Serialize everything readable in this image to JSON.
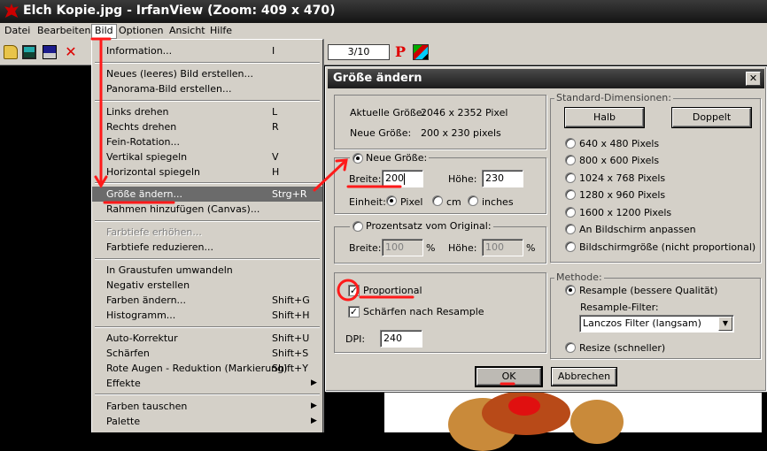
{
  "window": {
    "title": "Elch Kopie.jpg - IrfanView (Zoom: 409 x 470)"
  },
  "menubar": {
    "items": [
      {
        "label": "Datei"
      },
      {
        "label": "Bearbeiten"
      },
      {
        "label": "Bild"
      },
      {
        "label": "Optionen"
      },
      {
        "label": "Ansicht"
      },
      {
        "label": "Hilfe"
      }
    ]
  },
  "toolbar": {
    "page_counter": "3/10",
    "p_label": "P"
  },
  "bild_menu": {
    "items": [
      {
        "label": "Information...",
        "shortcut": "I"
      },
      {
        "label": "Neues (leeres) Bild erstellen...",
        "shortcut": ""
      },
      {
        "label": "Panorama-Bild erstellen...",
        "shortcut": ""
      },
      {
        "label": "Links drehen",
        "shortcut": "L"
      },
      {
        "label": "Rechts drehen",
        "shortcut": "R"
      },
      {
        "label": "Fein-Rotation...",
        "shortcut": ""
      },
      {
        "label": "Vertikal spiegeln",
        "shortcut": "V"
      },
      {
        "label": "Horizontal spiegeln",
        "shortcut": "H"
      },
      {
        "label": "Größe ändern...",
        "shortcut": "Strg+R"
      },
      {
        "label": "Rahmen hinzufügen (Canvas)...",
        "shortcut": ""
      },
      {
        "label": "Farbtiefe erhöhen...",
        "shortcut": ""
      },
      {
        "label": "Farbtiefe reduzieren...",
        "shortcut": ""
      },
      {
        "label": "In Graustufen umwandeln",
        "shortcut": ""
      },
      {
        "label": "Negativ erstellen",
        "shortcut": ""
      },
      {
        "label": "Farben ändern...",
        "shortcut": "Shift+G"
      },
      {
        "label": "Histogramm...",
        "shortcut": "Shift+H"
      },
      {
        "label": "Auto-Korrektur",
        "shortcut": "Shift+U"
      },
      {
        "label": "Schärfen",
        "shortcut": "Shift+S"
      },
      {
        "label": "Rote Augen - Reduktion (Markierung)",
        "shortcut": "Shift+Y"
      },
      {
        "label": "Effekte",
        "shortcut": ""
      },
      {
        "label": "Farben tauschen",
        "shortcut": ""
      },
      {
        "label": "Palette",
        "shortcut": ""
      }
    ]
  },
  "dialog": {
    "title": "Größe ändern",
    "current_size_label": "Aktuelle Größe:",
    "current_size_value": "2046  x  2352  Pixel",
    "new_size_label": "Neue Größe:",
    "new_size_value": "200  x  230  pixels",
    "new_size_group": {
      "radio_label": "Neue Größe:",
      "width_label": "Breite:",
      "width_value": "200",
      "height_label": "Höhe:",
      "height_value": "230",
      "unit_label": "Einheit:",
      "unit_pixel": "Pixel",
      "unit_cm": "cm",
      "unit_inches": "inches"
    },
    "percent_group": {
      "radio_label": "Prozentsatz vom Original:",
      "width_label": "Breite:",
      "width_value": "100",
      "height_label": "Höhe:",
      "height_value": "100",
      "percent_sign": "%"
    },
    "proportional_label": "Proportional",
    "sharpen_label": "Schärfen nach Resample",
    "dpi_label": "DPI:",
    "dpi_value": "240",
    "standard_dims": {
      "label": "Standard-Dimensionen:",
      "half_button": "Halb",
      "double_button": "Doppelt",
      "options": [
        "640 x 480 Pixels",
        "800 x 600 Pixels",
        "1024 x 768 Pixels",
        "1280 x 960 Pixels",
        "1600 x 1200 Pixels",
        "An Bildschirm anpassen",
        "Bildschirmgröße (nicht proportional)"
      ]
    },
    "method": {
      "label": "Methode:",
      "resample_label": "Resample (bessere Qualität)",
      "filter_label": "Resample-Filter:",
      "filter_value": "Lanczos Filter (langsam)",
      "resize_label": "Resize (schneller)"
    },
    "ok_button": "OK",
    "cancel_button": "Abbrechen"
  }
}
